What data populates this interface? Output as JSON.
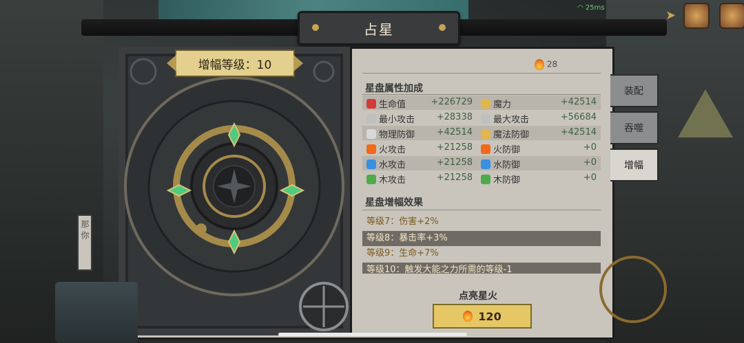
{
  "window": {
    "title": "占星"
  },
  "status": {
    "ping": "25ms"
  },
  "board": {
    "level_label": "增幅等级：10"
  },
  "currency": {
    "stardust": "28"
  },
  "attributes": {
    "title": "星盘属性加成",
    "rows": [
      {
        "left_icon": "heart-icon",
        "left_label": "生命值",
        "left_value": "+226729",
        "right_icon": "wand-icon",
        "right_label": "魔力",
        "right_value": "+42514"
      },
      {
        "left_icon": "sword-icon",
        "left_label": "最小攻击",
        "left_value": "+28338",
        "right_icon": "sword-icon",
        "right_label": "最大攻击",
        "right_value": "+56684"
      },
      {
        "left_icon": "shield-icon",
        "left_label": "物理防御",
        "left_value": "+42514",
        "right_icon": "wand-icon",
        "right_label": "魔法防御",
        "right_value": "+42514"
      },
      {
        "left_icon": "fire-icon",
        "left_label": "火攻击",
        "left_value": "+21258",
        "right_icon": "fire-icon",
        "right_label": "火防御",
        "right_value": "+0"
      },
      {
        "left_icon": "water-icon",
        "left_label": "水攻击",
        "left_value": "+21258",
        "right_icon": "water-icon",
        "right_label": "水防御",
        "right_value": "+0"
      },
      {
        "left_icon": "leaf-icon",
        "left_label": "木攻击",
        "left_value": "+21258",
        "right_icon": "leaf-icon",
        "right_label": "木防御",
        "right_value": "+0"
      }
    ]
  },
  "effects": {
    "title": "星盘增幅效果",
    "items": [
      "等级7：伤害+2%",
      "等级8：暴击率+3%",
      "等级9：生命+7%",
      "等级10：触发大能之力所需的等级-1"
    ]
  },
  "light_up": {
    "label": "点亮星火",
    "cost": "120"
  },
  "tabs": [
    {
      "label": "装配",
      "active": false
    },
    {
      "label": "吞噬",
      "active": false
    },
    {
      "label": "增幅",
      "active": true
    }
  ],
  "side_note": "那 你",
  "colors": {
    "banner": "#e3cf8e",
    "button": "#e5c766",
    "panel": "#c9c5bd",
    "value_green": "#3d5f3d"
  }
}
